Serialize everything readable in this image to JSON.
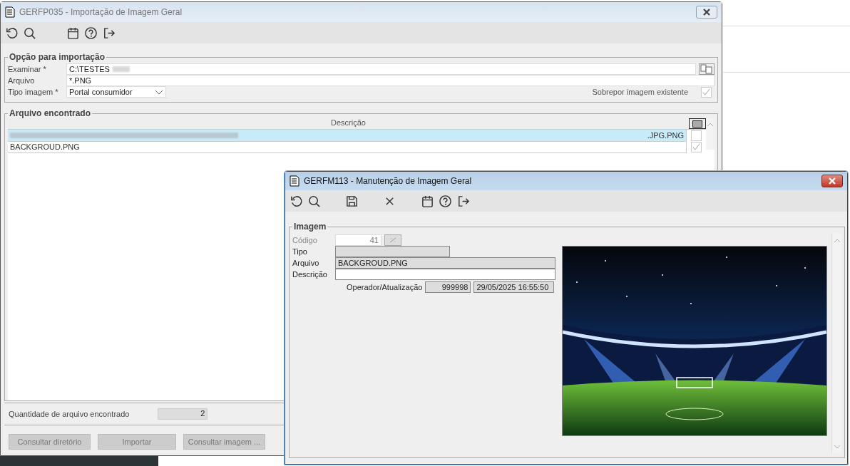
{
  "import_window": {
    "title": "GERFP035 - Importação de Imagem Geral",
    "options": {
      "legend": "Opção para importação",
      "examinar_label": "Examinar *",
      "examinar_value": "C:\\TESTES",
      "arquivo_label": "Arquivo",
      "arquivo_value": "*.PNG",
      "tipo_label": "Tipo imagem *",
      "tipo_value": "Portal consumidor",
      "sobrepor_label": "Sobrepor imagem existente",
      "sobrepor_checked": true
    },
    "found": {
      "legend": "Arquivo encontrado",
      "column": "Descrição",
      "rows": [
        {
          "name": ".JPG.PNG",
          "redacted": true,
          "selected": true,
          "checked": false
        },
        {
          "name": "BACKGROUD.PNG",
          "redacted": false,
          "selected": false,
          "checked": true
        }
      ]
    },
    "count_label": "Quantidade de arquivo encontrado",
    "count_value": "2",
    "buttons": [
      "Consultar diretório",
      "Importar",
      "Consultar imagem ..."
    ]
  },
  "edit_window": {
    "title": "GERFM113 - Manutenção de Imagem Geral",
    "legend": "Imagem",
    "fields": [
      {
        "label": "Código",
        "value": "41",
        "kind": "code",
        "disabled": true
      },
      {
        "label": "Tipo",
        "kind": "short",
        "disabled": false
      },
      {
        "label": "Arquivo",
        "value": "BACKGROUD.PNG",
        "kind": "long",
        "disabled": false
      },
      {
        "label": "Descrição",
        "kind": "input",
        "disabled": false
      }
    ],
    "operator_label": "Operador/Atualização",
    "operator_value": "999998",
    "updated_value": "29/05/2025 16:55:50"
  }
}
